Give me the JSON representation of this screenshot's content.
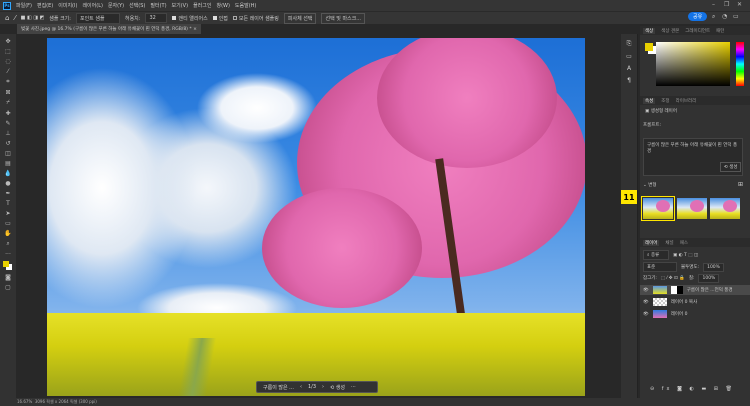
{
  "app": {
    "logo": "Ps",
    "menu": [
      "파일(F)",
      "편집(E)",
      "이미지(I)",
      "레이어(L)",
      "문자(Y)",
      "선택(S)",
      "필터(T)",
      "보기(V)",
      "플러그인",
      "창(W)",
      "도움말(H)"
    ]
  },
  "options": {
    "sample_size_label": "샘플 크기:",
    "sample_size_value": "포인트 샘플",
    "tolerance_label": "허용치:",
    "tolerance_value": "32",
    "anti_alias": "앤티 앨리어스",
    "contiguous": "인접",
    "all_layers": "모든 레이어 샘플링",
    "select_subject": "피사체 선택",
    "select_mask": "선택 및 마스크...",
    "share": "공유"
  },
  "document": {
    "tab": "벚꽃 사진.jpeg @ 16.7% (구름이 많은 푸른 하늘 아래 유채꽃이 핀 언덕 풍경, RGB/8) *"
  },
  "context_bar": {
    "prompt": "구름이 많은 ...",
    "page": "1/3",
    "generate": "생성",
    "more": "···"
  },
  "status": {
    "zoom": "16.67%",
    "info": "3096 픽셀 x 2064 픽셀 (300 ppi)"
  },
  "color_panel": {
    "tabs": [
      "색상",
      "색상 견본",
      "그레이디언트",
      "패턴"
    ]
  },
  "properties": {
    "tabs": [
      "속성",
      "조정",
      "라이브러리"
    ],
    "layer_type": "생성형 레이어",
    "prompt_label": "프롬프트:",
    "prompt_text": "구름이 많은 푸른 하늘 아래 유채꽃이 핀 언덕 풍경",
    "generate": "생성",
    "variations": "변형"
  },
  "badge": "11",
  "layers": {
    "tabs": [
      "레이어",
      "채널",
      "패스"
    ],
    "filter": "종류",
    "blend": "표준",
    "opacity_label": "불투명도:",
    "opacity": "100%",
    "lock_label": "잠그기:",
    "fill_label": "칠:",
    "fill": "100%",
    "items": [
      {
        "name": "구름이 많은 ...언덕 풍경"
      },
      {
        "name": "레이어 0 복사"
      },
      {
        "name": "레이어 0"
      }
    ]
  },
  "colors": {
    "accent": "#1473e6",
    "badge": "#ffe600",
    "foreground": "#e8d000"
  }
}
